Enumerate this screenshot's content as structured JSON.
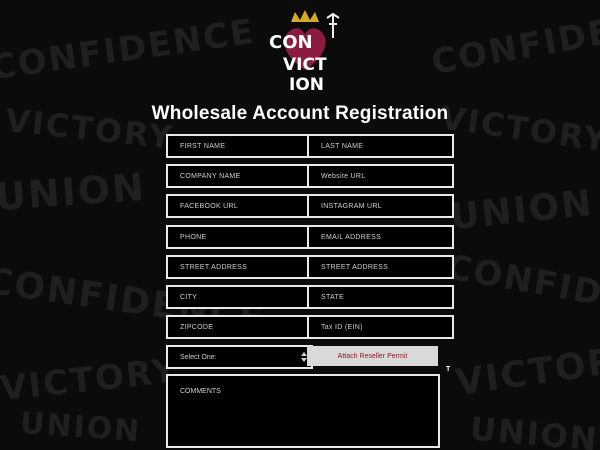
{
  "page": {
    "title": "Wholesale Account Registration"
  },
  "logo": {
    "text_line1": "CON",
    "text_line2": "VICT",
    "text_line3": "ION",
    "accent_heart": "#8b1c3f",
    "crown_color": "#d4a82b"
  },
  "form": {
    "fields": [
      {
        "id": "first_name",
        "placeholder": "FIRST NAME"
      },
      {
        "id": "last_name",
        "placeholder": "LAST NAME"
      },
      {
        "id": "company_name",
        "placeholder": "COMPANY NAME"
      },
      {
        "id": "website_url",
        "placeholder": "Website URL"
      },
      {
        "id": "facebook_url",
        "placeholder": "FACEBOOK URL"
      },
      {
        "id": "instagram_url",
        "placeholder": "INSTAGRAM URL"
      },
      {
        "id": "phone",
        "placeholder": "PHONE"
      },
      {
        "id": "email",
        "placeholder": "EMAIL ADDRESS"
      },
      {
        "id": "street1",
        "placeholder": "STREET ADDRESS"
      },
      {
        "id": "street2",
        "placeholder": "STREET ADDRESS"
      },
      {
        "id": "city",
        "placeholder": "CITY"
      },
      {
        "id": "state",
        "placeholder": "STATE"
      },
      {
        "id": "zipcode",
        "placeholder": "ZIPCODE"
      },
      {
        "id": "tax_id",
        "placeholder": "Tax ID (EIN)"
      }
    ],
    "select": {
      "selected": "Select One:"
    },
    "attach_button": "Attach Reseller Permit",
    "side_text": "T",
    "comments_placeholder": "COMMENTS"
  },
  "background": {
    "words": [
      "CONFIDENCE",
      "VICTORY",
      "UNION",
      "CONFIDENCE",
      "VICTORY",
      "UNION",
      "CONFIDENCE",
      "VICTORY",
      "UNION",
      "CONFIDENCE",
      "VICTORY",
      "UNION"
    ]
  },
  "colors": {
    "background": "#0b0b0b",
    "field_border": "#e9e9e9",
    "attach_bg": "#d9d9d9",
    "attach_text": "#8b1f2a"
  }
}
